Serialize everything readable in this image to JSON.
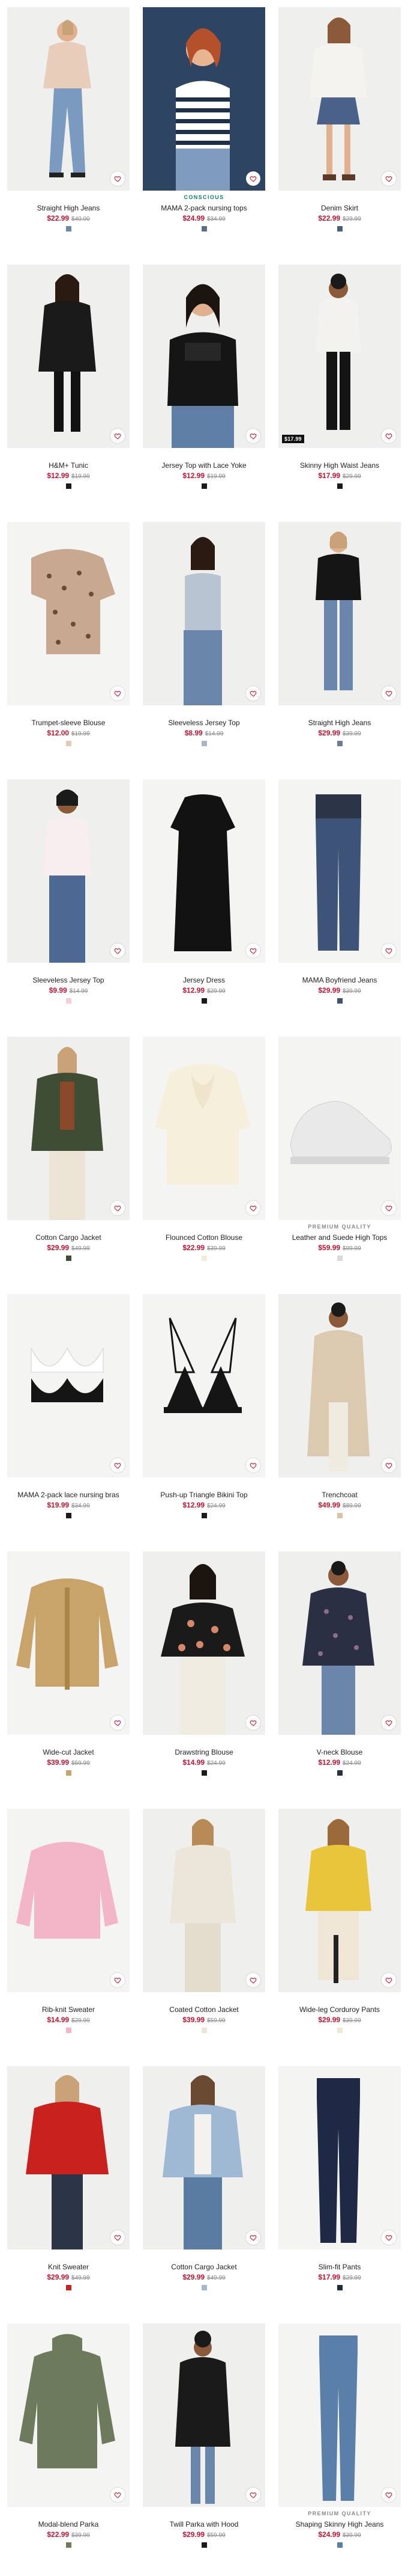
{
  "products": [
    {
      "title": "Straight High Jeans",
      "price": "$22.99",
      "was": "$40.00",
      "swatch": "#6b8aab",
      "tag": "",
      "badge": ""
    },
    {
      "title": "MAMA 2-pack nursing tops",
      "price": "$24.99",
      "was": "$34.99",
      "swatch": "#5b6f86",
      "tag": "",
      "badge": "CONSCIOUS"
    },
    {
      "title": "Denim Skirt",
      "price": "$22.99",
      "was": "$29.99",
      "swatch": "#4a5f7e",
      "tag": "",
      "badge": ""
    },
    {
      "title": "H&M+ Tunic",
      "price": "$12.99",
      "was": "$19.99",
      "swatch": "#1a1a1a",
      "tag": "",
      "badge": ""
    },
    {
      "title": "Jersey Top with Lace Yoke",
      "price": "$12.99",
      "was": "$19.99",
      "swatch": "#1a1a1a",
      "tag": "",
      "badge": ""
    },
    {
      "title": "Skinny High Waist Jeans",
      "price": "$17.99",
      "was": "$29.99",
      "swatch": "#1a1a1a",
      "tag": "$17.99",
      "badge": ""
    },
    {
      "title": "Trumpet-sleeve Blouse",
      "price": "$12.00",
      "was": "$19.99",
      "swatch": "#e6c9b8",
      "tag": "",
      "badge": ""
    },
    {
      "title": "Sleeveless Jersey Top",
      "price": "$8.99",
      "was": "$14.99",
      "swatch": "#a8b7c8",
      "tag": "",
      "badge": ""
    },
    {
      "title": "Straight High Jeans",
      "price": "$29.99",
      "was": "$39.99",
      "swatch": "#6b7d92",
      "tag": "",
      "badge": ""
    },
    {
      "title": "Sleeveless Jersey Top",
      "price": "$9.99",
      "was": "$14.99",
      "swatch": "#f1d0d6",
      "tag": "",
      "badge": ""
    },
    {
      "title": "Jersey Dress",
      "price": "$12.99",
      "was": "$29.99",
      "swatch": "#1a1a1a",
      "tag": "",
      "badge": ""
    },
    {
      "title": "MAMA Boyfriend Jeans",
      "price": "$29.99",
      "was": "$39.99",
      "swatch": "#3e5272",
      "tag": "",
      "badge": ""
    },
    {
      "title": "Cotton Cargo Jacket",
      "price": "$29.99",
      "was": "$49.99",
      "swatch": "#3f4d34",
      "tag": "",
      "badge": ""
    },
    {
      "title": "Flounced Cotton Blouse",
      "price": "$22.99",
      "was": "$39.99",
      "swatch": "#f3ecd9",
      "tag": "",
      "badge": ""
    },
    {
      "title": "Leather and Suede High Tops",
      "price": "$59.99",
      "was": "$99.99",
      "swatch": "#d9d9d9",
      "tag": "",
      "badge": "PREMIUM QUALITY"
    },
    {
      "title": "MAMA 2-pack lace nursing bras",
      "price": "$19.99",
      "was": "$34.99",
      "swatch": "#1a1a1a",
      "tag": "",
      "badge": ""
    },
    {
      "title": "Push-up Triangle Bikini Top",
      "price": "$12.99",
      "was": "$24.99",
      "swatch": "#1a1a1a",
      "tag": "",
      "badge": ""
    },
    {
      "title": "Trenchcoat",
      "price": "$49.99",
      "was": "$89.99",
      "swatch": "#d8c4a2",
      "tag": "",
      "badge": ""
    },
    {
      "title": "Wide-cut Jacket",
      "price": "$39.99",
      "was": "$59.99",
      "swatch": "#c9a46a",
      "tag": "",
      "badge": ""
    },
    {
      "title": "Drawstring Blouse",
      "price": "$14.99",
      "was": "$24.99",
      "swatch": "#1a1a1a",
      "tag": "",
      "badge": ""
    },
    {
      "title": "V-neck Blouse",
      "price": "$12.99",
      "was": "$24.99",
      "swatch": "#2b2f44",
      "tag": "",
      "badge": ""
    },
    {
      "title": "Rib-knit Sweater",
      "price": "$14.99",
      "was": "$29.99",
      "swatch": "#f2b6c8",
      "tag": "",
      "badge": ""
    },
    {
      "title": "Coated Cotton Jacket",
      "price": "$39.99",
      "was": "$59.99",
      "swatch": "#ece6da",
      "tag": "",
      "badge": ""
    },
    {
      "title": "Wide-leg Corduroy Pants",
      "price": "$29.99",
      "was": "$39.99",
      "swatch": "#efe6d6",
      "tag": "",
      "badge": ""
    },
    {
      "title": "Knit Sweater",
      "price": "$29.99",
      "was": "$49.99",
      "swatch": "#c8211e",
      "tag": "",
      "badge": ""
    },
    {
      "title": "Cotton Cargo Jacket",
      "price": "$29.99",
      "was": "$49.99",
      "swatch": "#9fb9d4",
      "tag": "",
      "badge": ""
    },
    {
      "title": "Slim-fit Pants",
      "price": "$17.99",
      "was": "$29.99",
      "swatch": "#1e2a45",
      "tag": "",
      "badge": ""
    },
    {
      "title": "Modal-blend Parka",
      "price": "$22.99",
      "was": "$39.99",
      "swatch": "#6d7a5c",
      "tag": "",
      "badge": ""
    },
    {
      "title": "Twill Parka with Hood",
      "price": "$29.99",
      "was": "$59.99",
      "swatch": "#1a1a1a",
      "tag": "",
      "badge": ""
    },
    {
      "title": "Shaping Skinny High Jeans",
      "price": "$24.99",
      "was": "$39.99",
      "swatch": "#5a7fa8",
      "tag": "",
      "badge": "PREMIUM QUALITY"
    }
  ],
  "icons": {
    "favorite": "heart-outline-icon"
  },
  "colors": {
    "sale": "#c8102e",
    "conscious": "#0a7d6b",
    "premium": "#888888"
  }
}
